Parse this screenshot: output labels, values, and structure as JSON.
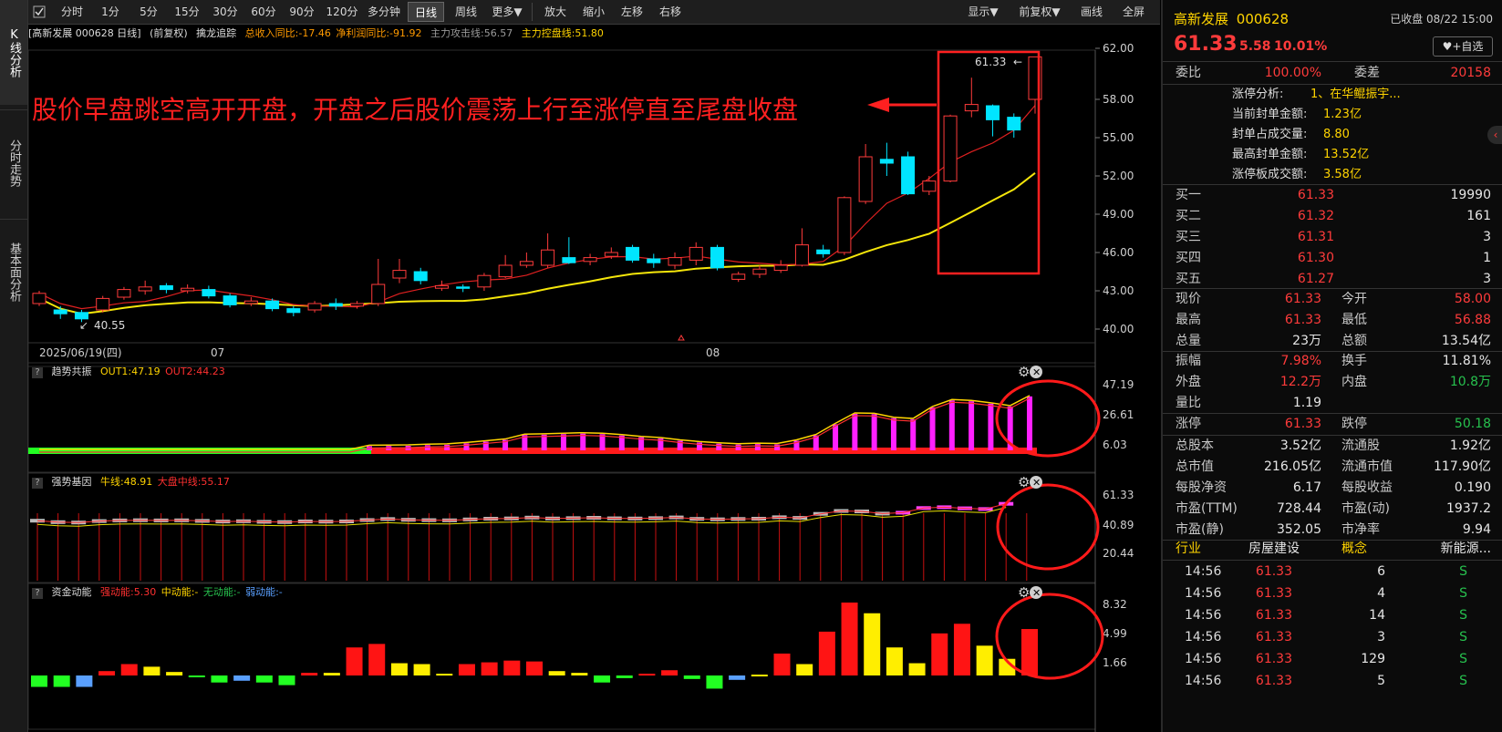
{
  "side_tabs": [
    "K线分析",
    "分时走势",
    "基本面分析"
  ],
  "toolbar": {
    "periods": [
      "分时",
      "1分",
      "5分",
      "15分",
      "30分",
      "60分",
      "90分",
      "120分",
      "多分钟",
      "日线",
      "周线",
      "更多▼"
    ],
    "actions": [
      "放大",
      "缩小",
      "左移",
      "右移"
    ],
    "right": [
      "显示▼",
      "前复权▼",
      "画线",
      "全屏"
    ],
    "active": "日线"
  },
  "main_header": {
    "stock": "[高新发展 000628 日线]",
    "adjust": "(前复权)",
    "indicator": "擒龙追踪",
    "rev": "总收入同比:-17.46",
    "profit": "净利润同比:-91.92",
    "attack": "主力攻击线:56.57",
    "control": "主力控盘线:51.80"
  },
  "annotation": "股价早盘跳空高开开盘，开盘之后股价震荡上行至涨停直至尾盘收盘",
  "price_axis": [
    "62.00",
    "58.00",
    "55.00",
    "52.00",
    "49.00",
    "46.00",
    "43.00",
    "40.00"
  ],
  "date_labels": [
    "2025/06/19(四)",
    "07",
    "08"
  ],
  "high_label": "61.33",
  "low_label": "40.55",
  "panel1": {
    "name": "趋势共振",
    "out1": "OUT1:47.19",
    "out2": "OUT2:44.23",
    "axis": [
      "47.19",
      "26.61",
      "6.03"
    ]
  },
  "panel2": {
    "name": "强势基因",
    "bull": "牛线:48.91",
    "mid": "大盘中线:55.17",
    "axis": [
      "61.33",
      "40.89",
      "20.44"
    ]
  },
  "panel3": {
    "name": "资金动能",
    "strong": "强动能:5.30",
    "medium": "中动能:-",
    "none": "无动能:-",
    "weak": "弱动能:-",
    "axis": [
      "8.32",
      "4.99",
      "1.66"
    ]
  },
  "chart_data": {
    "type": "candlestick",
    "ylim": [
      40,
      62
    ],
    "candles": [
      [
        42.0,
        42.8,
        43.0,
        41.8
      ],
      [
        41.5,
        41.2,
        41.8,
        40.8
      ],
      [
        41.3,
        40.8,
        41.5,
        40.55
      ],
      [
        41.5,
        42.4,
        42.6,
        41.3
      ],
      [
        42.5,
        43.1,
        43.3,
        42.3
      ],
      [
        43.0,
        43.3,
        43.8,
        42.7
      ],
      [
        43.4,
        43.1,
        43.6,
        42.8
      ],
      [
        43.0,
        43.2,
        43.5,
        42.8
      ],
      [
        43.1,
        42.6,
        43.4,
        42.4
      ],
      [
        42.6,
        41.9,
        42.8,
        41.7
      ],
      [
        42.0,
        42.2,
        42.5,
        41.8
      ],
      [
        42.2,
        41.6,
        42.4,
        41.4
      ],
      [
        41.6,
        41.3,
        41.8,
        41.0
      ],
      [
        41.5,
        42.0,
        42.2,
        41.3
      ],
      [
        42.0,
        41.8,
        42.4,
        41.5
      ],
      [
        41.8,
        42.0,
        42.2,
        41.6
      ],
      [
        42.0,
        43.5,
        45.5,
        41.8
      ],
      [
        44.0,
        44.6,
        45.5,
        43.6
      ],
      [
        44.5,
        43.8,
        44.8,
        43.5
      ],
      [
        43.2,
        43.4,
        43.8,
        43.0
      ],
      [
        43.3,
        43.2,
        43.5,
        42.9
      ],
      [
        43.3,
        44.2,
        44.4,
        43.0
      ],
      [
        44.1,
        45.0,
        45.8,
        44.0
      ],
      [
        45.0,
        45.3,
        46.0,
        44.8
      ],
      [
        45.0,
        46.2,
        47.5,
        44.8
      ],
      [
        45.6,
        45.2,
        47.2,
        45.1
      ],
      [
        45.3,
        45.6,
        45.9,
        45.0
      ],
      [
        45.7,
        46.0,
        46.4,
        45.5
      ],
      [
        46.4,
        45.4,
        46.6,
        45.2
      ],
      [
        45.5,
        45.2,
        45.9,
        44.8
      ],
      [
        45.0,
        45.6,
        46.0,
        44.7
      ],
      [
        45.4,
        46.4,
        46.8,
        45.0
      ],
      [
        46.4,
        44.8,
        46.6,
        44.6
      ],
      [
        43.9,
        44.3,
        44.5,
        43.7
      ],
      [
        44.3,
        44.7,
        45.0,
        44.0
      ],
      [
        44.6,
        45.0,
        45.4,
        44.4
      ],
      [
        45.0,
        46.6,
        47.9,
        44.9
      ],
      [
        46.2,
        45.9,
        46.6,
        45.6
      ],
      [
        46.0,
        50.3,
        50.4,
        45.8
      ],
      [
        50.0,
        53.5,
        54.5,
        49.8
      ],
      [
        53.3,
        53.0,
        54.6,
        52.0
      ],
      [
        53.5,
        50.6,
        53.9,
        50.5
      ],
      [
        50.8,
        51.6,
        52.0,
        50.5
      ],
      [
        51.6,
        56.7,
        56.8,
        51.5
      ],
      [
        57.1,
        57.6,
        59.7,
        56.6
      ],
      [
        57.5,
        56.4,
        57.6,
        55.1
      ],
      [
        56.6,
        55.6,
        56.9,
        55.0
      ],
      [
        58.0,
        61.33,
        61.33,
        56.88
      ]
    ],
    "ma_red_label": "主力攻击线",
    "ma_yellow_label": "主力控盘线",
    "panel1_bars": [
      6,
      6,
      6,
      6,
      6,
      6,
      6,
      6,
      6,
      6,
      6,
      6,
      6,
      6,
      6,
      6,
      6,
      8.4,
      8.5,
      8.6,
      9.0,
      9.2,
      10,
      11,
      12,
      14.8,
      15,
      15.3,
      15.6,
      15.3,
      14.5,
      13.5,
      12.8,
      11.5,
      10.5,
      9.8,
      9.3,
      9.6,
      9.4,
      11.5,
      14.6,
      21,
      27,
      26.8,
      24.5,
      23.8,
      30.7,
      34.7,
      34.2,
      32.8,
      31.2,
      37
    ],
    "panel3_bars": [
      {
        "v": 1.3,
        "c": "green"
      },
      {
        "v": 1.3,
        "c": "green"
      },
      {
        "v": 1.3,
        "c": "blue"
      },
      {
        "v": 0.5,
        "c": "red"
      },
      {
        "v": 1.3,
        "c": "red"
      },
      {
        "v": 1.0,
        "c": "yellow"
      },
      {
        "v": 0.4,
        "c": "yellow"
      },
      {
        "v": 0.1,
        "c": "green"
      },
      {
        "v": 0.8,
        "c": "green"
      },
      {
        "v": 0.6,
        "c": "blue"
      },
      {
        "v": 0.8,
        "c": "green"
      },
      {
        "v": 1.1,
        "c": "green"
      },
      {
        "v": 0.3,
        "c": "red"
      },
      {
        "v": 0.3,
        "c": "yellow"
      },
      {
        "v": 3.2,
        "c": "red"
      },
      {
        "v": 3.6,
        "c": "red"
      },
      {
        "v": 1.4,
        "c": "yellow"
      },
      {
        "v": 1.3,
        "c": "yellow"
      },
      {
        "v": 0.2,
        "c": "yellow"
      },
      {
        "v": 1.3,
        "c": "red"
      },
      {
        "v": 1.5,
        "c": "red"
      },
      {
        "v": 1.7,
        "c": "red"
      },
      {
        "v": 1.6,
        "c": "red"
      },
      {
        "v": 0.5,
        "c": "yellow"
      },
      {
        "v": 0.3,
        "c": "yellow"
      },
      {
        "v": 0.8,
        "c": "green"
      },
      {
        "v": 0.3,
        "c": "green"
      },
      {
        "v": 0.2,
        "c": "red"
      },
      {
        "v": 0.6,
        "c": "red"
      },
      {
        "v": 0.4,
        "c": "green"
      },
      {
        "v": 1.5,
        "c": "green"
      },
      {
        "v": 0.5,
        "c": "blue"
      },
      {
        "v": 0.1,
        "c": "yellow"
      },
      {
        "v": 2.5,
        "c": "red"
      },
      {
        "v": 1.3,
        "c": "yellow"
      },
      {
        "v": 5.0,
        "c": "red"
      },
      {
        "v": 8.32,
        "c": "red"
      },
      {
        "v": 7.1,
        "c": "yellow"
      },
      {
        "v": 3.2,
        "c": "yellow"
      },
      {
        "v": 1.4,
        "c": "yellow"
      },
      {
        "v": 4.8,
        "c": "red"
      },
      {
        "v": 5.9,
        "c": "red"
      },
      {
        "v": 3.4,
        "c": "yellow"
      },
      {
        "v": 1.9,
        "c": "yellow"
      },
      {
        "v": 5.3,
        "c": "red"
      }
    ]
  },
  "quote": {
    "name": "高新发展",
    "code": "000628",
    "status": "已收盘 08/22 15:00",
    "price": "61.33",
    "change": "5.58",
    "pct": "10.01%",
    "watch_btn": "+自选",
    "wb_label": "委比",
    "wb": "100.00%",
    "wc_label": "委差",
    "wc": "20158",
    "limit_lines": [
      {
        "k": "涨停分析:",
        "v": "1、在华鲲振宇..."
      },
      {
        "k": "当前封单金额:",
        "v": "1.23亿"
      },
      {
        "k": "封单占成交量:",
        "v": "8.80"
      },
      {
        "k": "最高封单金额:",
        "v": "13.52亿"
      },
      {
        "k": "涨停板成交额:",
        "v": "3.58亿"
      }
    ],
    "bids": [
      {
        "k": "买一",
        "p": "61.33",
        "v": "19990"
      },
      {
        "k": "买二",
        "p": "61.32",
        "v": "161"
      },
      {
        "k": "买三",
        "p": "61.31",
        "v": "3"
      },
      {
        "k": "买四",
        "p": "61.30",
        "v": "1"
      },
      {
        "k": "买五",
        "p": "61.27",
        "v": "3"
      }
    ],
    "stats1": [
      {
        "k1": "现价",
        "v1": "61.33",
        "c1": "red",
        "k2": "今开",
        "v2": "58.00",
        "c2": "red"
      },
      {
        "k1": "最高",
        "v1": "61.33",
        "c1": "red",
        "k2": "最低",
        "v2": "56.88",
        "c2": "red"
      },
      {
        "k1": "总量",
        "v1": "23万",
        "c1": "white",
        "k2": "总额",
        "v2": "13.54亿",
        "c2": "white"
      }
    ],
    "stats2": [
      {
        "k1": "振幅",
        "v1": "7.98%",
        "c1": "red",
        "k2": "换手",
        "v2": "11.81%",
        "c2": "white"
      },
      {
        "k1": "外盘",
        "v1": "12.2万",
        "c1": "red",
        "k2": "内盘",
        "v2": "10.8万",
        "c2": "green"
      },
      {
        "k1": "量比",
        "v1": "1.19",
        "c1": "white",
        "k2": "",
        "v2": "",
        "c2": "white"
      }
    ],
    "stats3": [
      {
        "k1": "涨停",
        "v1": "61.33",
        "c1": "red",
        "k2": "跌停",
        "v2": "50.18",
        "c2": "green"
      }
    ],
    "stats4": [
      {
        "k1": "总股本",
        "v1": "3.52亿",
        "c1": "white",
        "k2": "流通股",
        "v2": "1.92亿",
        "c2": "white"
      },
      {
        "k1": "总市值",
        "v1": "216.05亿",
        "c1": "white",
        "k2": "流通市值",
        "v2": "117.90亿",
        "c2": "white"
      },
      {
        "k1": "每股净资",
        "v1": "6.17",
        "c1": "white",
        "k2": "每股收益",
        "v2": "0.190",
        "c2": "white"
      },
      {
        "k1": "市盈(TTM)",
        "v1": "728.44",
        "c1": "white",
        "k2": "市盈(动)",
        "v2": "1937.2",
        "c2": "white"
      },
      {
        "k1": "市盈(静)",
        "v1": "352.05",
        "c1": "white",
        "k2": "市净率",
        "v2": "9.94",
        "c2": "white"
      }
    ],
    "industry": {
      "k1": "行业",
      "v1": "房屋建设",
      "k2": "概念",
      "v2": "新能源..."
    },
    "ticks": [
      {
        "t": "14:56",
        "p": "61.33",
        "v": "6",
        "s": "S"
      },
      {
        "t": "14:56",
        "p": "61.33",
        "v": "4",
        "s": "S"
      },
      {
        "t": "14:56",
        "p": "61.33",
        "v": "14",
        "s": "S"
      },
      {
        "t": "14:56",
        "p": "61.33",
        "v": "3",
        "s": "S"
      },
      {
        "t": "14:56",
        "p": "61.33",
        "v": "129",
        "s": "S"
      },
      {
        "t": "14:56",
        "p": "61.33",
        "v": "5",
        "s": "S"
      }
    ]
  },
  "colors": {
    "up": "#ff3b3b",
    "down": "#00e5ff",
    "ma_red": "#e02020",
    "ma_yellow": "#f5e60a",
    "annot": "#ff2020"
  }
}
